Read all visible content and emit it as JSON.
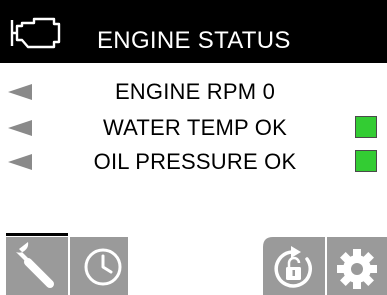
{
  "header": {
    "title": "ENGINE STATUS",
    "icon": "engine-icon"
  },
  "status_rows": [
    {
      "label": "ENGINE RPM 0",
      "indicator": null
    },
    {
      "label": "WATER TEMP OK",
      "indicator": "#33cc33"
    },
    {
      "label": "OIL PRESSURE OK",
      "indicator": "#33cc33"
    }
  ],
  "softkeys": [
    {
      "icon": "wrench-icon",
      "selected": true
    },
    {
      "icon": "clock-icon",
      "selected": false
    },
    {
      "icon": "unlock-cycle-icon",
      "selected": false
    },
    {
      "icon": "gear-icon",
      "selected": false
    }
  ],
  "colors": {
    "header_bg": "#000000",
    "header_text": "#ffffff",
    "ok_indicator": "#33cc33",
    "softkey_bg": "#9a9a9a",
    "arrow": "#8a8a8a"
  }
}
